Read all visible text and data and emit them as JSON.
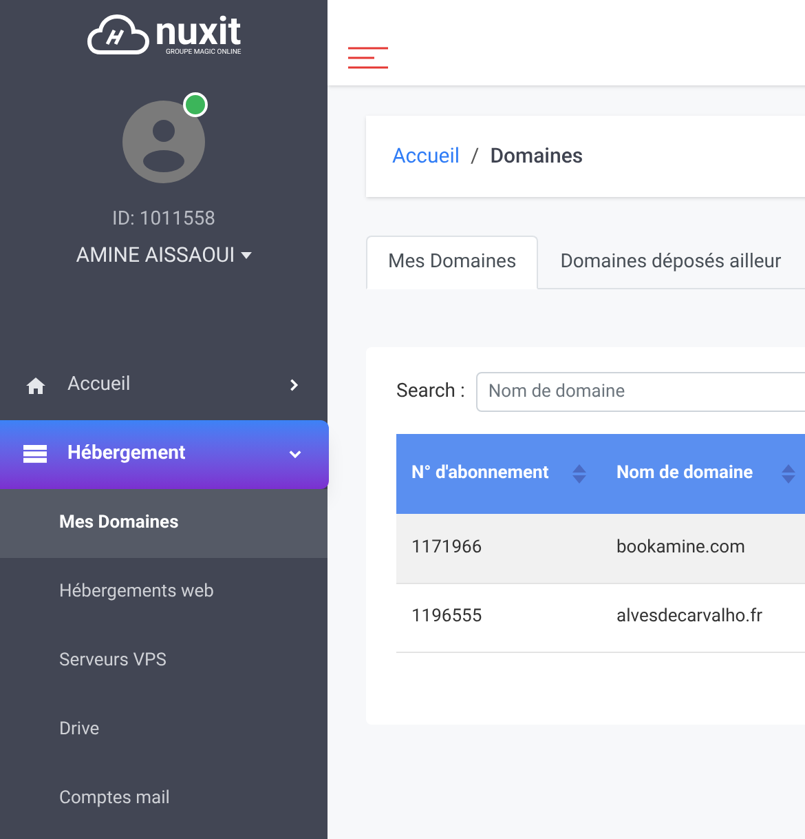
{
  "logo": {
    "wordmark": "nuxit",
    "tagline": "GROUPE MAGIC ONLINE"
  },
  "user": {
    "online": true,
    "id": "ID: 1011558",
    "name": "AMINE AISSAOUI"
  },
  "sidebar": {
    "items": [
      {
        "label": "Accueil",
        "expanded": false,
        "selected": false
      },
      {
        "label": "Hébergement",
        "expanded": true,
        "selected": true,
        "children": [
          {
            "label": "Mes Domaines",
            "selected": true
          },
          {
            "label": "Hébergements web",
            "selected": false
          },
          {
            "label": "Serveurs VPS",
            "selected": false
          },
          {
            "label": "Drive",
            "selected": false
          },
          {
            "label": "Comptes mail",
            "selected": false
          }
        ]
      }
    ]
  },
  "breadcrumb": {
    "link": "Accueil",
    "separator": "/",
    "current": "Domaines"
  },
  "tabs": [
    {
      "label": "Mes Domaines",
      "selected": true
    },
    {
      "label": "Domaines déposés ailleur",
      "selected": false
    }
  ],
  "search": {
    "label": "Search :",
    "placeholder": "Nom de domaine"
  },
  "table": {
    "columns": [
      "N° d'abonnement",
      "Nom de domaine"
    ],
    "rows": [
      [
        "1171966",
        "bookamine.com"
      ],
      [
        "1196555",
        "alvesdecarvalho.fr"
      ]
    ]
  }
}
